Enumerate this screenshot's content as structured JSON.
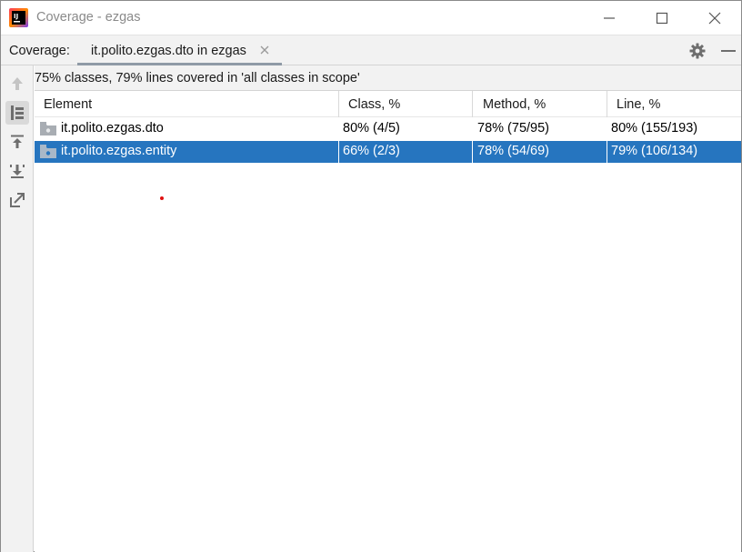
{
  "window": {
    "title": "Coverage - ezgas"
  },
  "tabbar": {
    "coverage_label": "Coverage:",
    "active_tab": "it.polito.ezgas.dto in ezgas"
  },
  "summary": {
    "text": "75% classes, 79% lines covered in 'all classes in scope'"
  },
  "table": {
    "columns": [
      "Element",
      "Class, %",
      "Method, %",
      "Line, %"
    ],
    "rows": [
      {
        "element": "it.polito.ezgas.dto",
        "class": "80% (4/5)",
        "method": "78% (75/95)",
        "line": "80% (155/193)",
        "selected": false
      },
      {
        "element": "it.polito.ezgas.entity",
        "class": "66% (2/3)",
        "method": "78% (54/69)",
        "line": "79% (106/134)",
        "selected": true
      }
    ]
  },
  "colors": {
    "selection": "#2675bf",
    "panel_background": "#f2f2f2",
    "tab_underline": "#8f9aa6"
  },
  "icons": [
    "intellij-app-icon",
    "minimize-icon",
    "maximize-icon",
    "close-icon",
    "tab-close-icon",
    "gear-icon",
    "hide-panel-icon",
    "arrow-up-icon",
    "flatten-packages-icon",
    "export-up-icon",
    "import-down-icon",
    "generate-report-icon",
    "package-folder-icon"
  ]
}
